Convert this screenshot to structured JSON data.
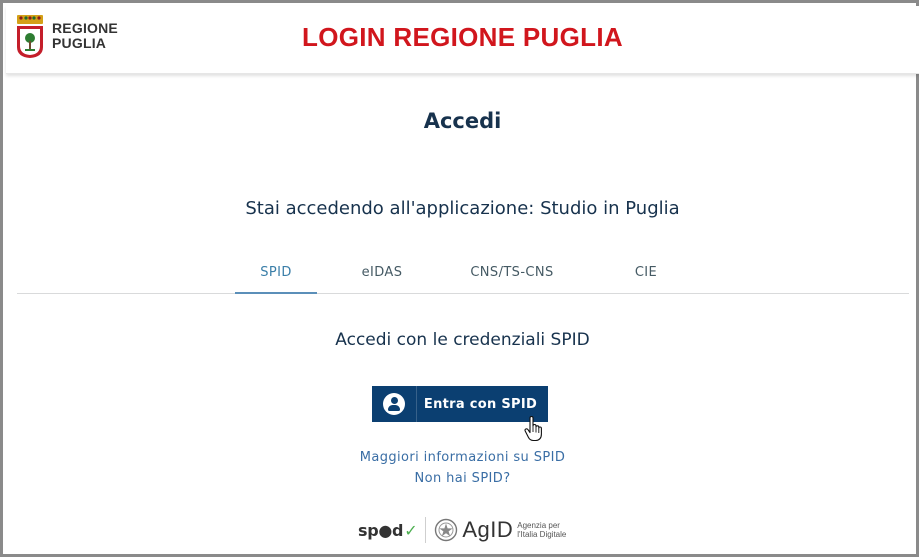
{
  "header": {
    "brand_line1": "REGIONE",
    "brand_line2": "PUGLIA",
    "app_title": "LOGIN REGIONE PUGLIA"
  },
  "main": {
    "title": "Accedi",
    "app_line": "Stai accedendo all'applicazione: Studio in Puglia",
    "tabs": [
      {
        "label": "SPID",
        "active": true
      },
      {
        "label": "eIDAS",
        "active": false
      },
      {
        "label": "CNS/TS-CNS",
        "active": false
      },
      {
        "label": "CIE",
        "active": false
      }
    ],
    "subtitle": "Accedi con le credenziali SPID",
    "spid_button_label": "Entra con SPID",
    "link_more_info": "Maggiori informazioni su SPID",
    "link_no_spid": "Non hai SPID?"
  },
  "footer": {
    "spid_logo_text": "sp●d",
    "agid_text": "AgID",
    "agid_sub1": "Agenzia per",
    "agid_sub2": "l'Italia Digitale"
  },
  "colors": {
    "header_title": "#d1161d",
    "button_bg": "#0b3f71",
    "link": "#3a6ea5",
    "text_dark": "#17324d",
    "tab_active": "#3a7ea8"
  },
  "icons": [
    "regione-puglia-crest-icon",
    "user-icon",
    "hand-cursor-icon",
    "repubblica-emblem-icon",
    "checkmark-icon"
  ]
}
